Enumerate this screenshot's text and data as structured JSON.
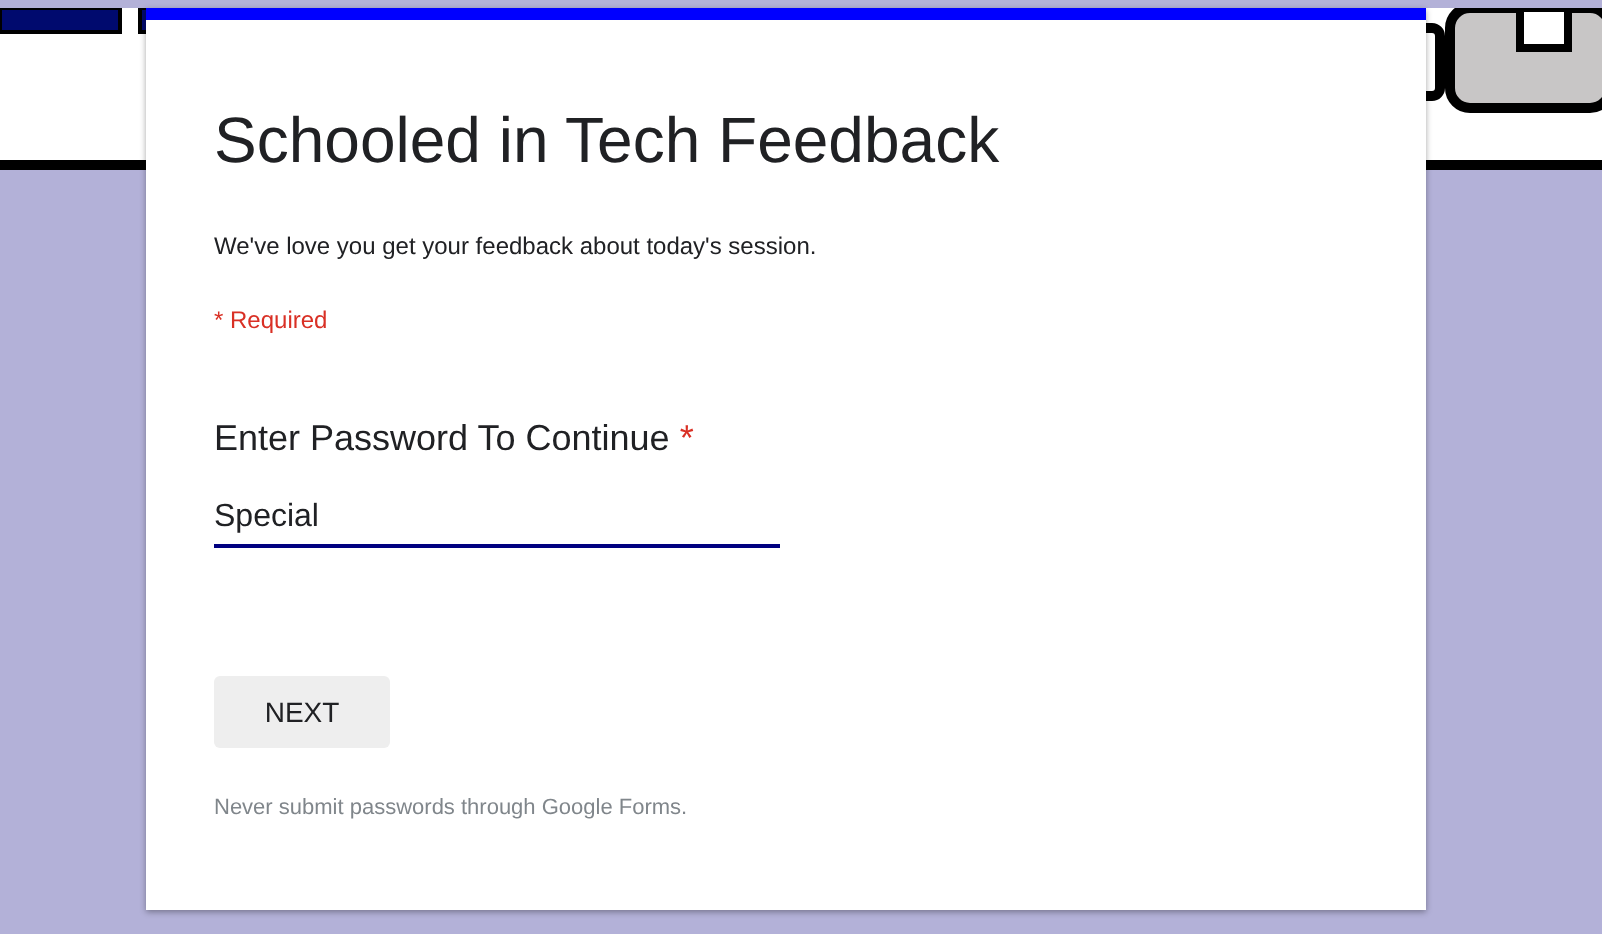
{
  "form": {
    "title": "Schooled in Tech Feedback",
    "description": "We've love you get your feedback about today's session.",
    "required_note": "* Required",
    "question": {
      "label": "Enter Password To Continue",
      "required_mark": "*",
      "value": "Special",
      "focused": true
    },
    "buttons": [
      {
        "label": "NEXT"
      }
    ],
    "footer_note": "Never submit passwords through Google Forms."
  }
}
